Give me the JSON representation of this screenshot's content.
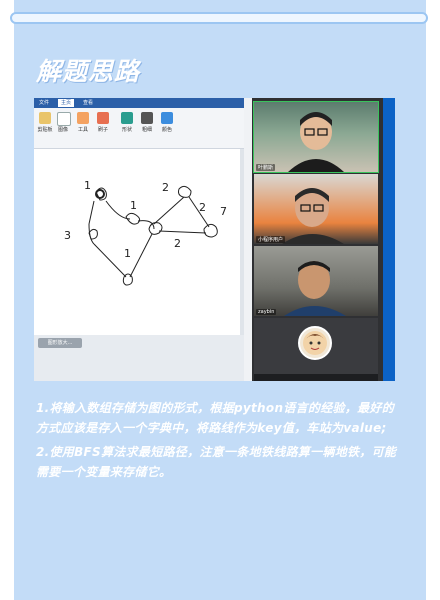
{
  "section_title": "解题思路",
  "screenshot": {
    "paint": {
      "tabs": [
        "文件",
        "主页",
        "查看"
      ],
      "ribbon_groups": [
        "剪贴板",
        "图像",
        "工具",
        "刷子",
        "形状",
        "粗细",
        "颜色"
      ],
      "status_button": "图形放大...",
      "sketch_labels": [
        "1",
        "1",
        "2",
        "2",
        "7",
        "3",
        "1",
        "2"
      ]
    },
    "video_tiles": [
      {
        "name": "叶鹏斯",
        "active": true
      },
      {
        "name": "小程序用户",
        "active": false
      },
      {
        "name": "zaybin",
        "active": false
      }
    ]
  },
  "paragraphs": [
    "1.将输入数组存储为图的形式，根据python语言的经验，最好的方式应该是存入一个字典中，将路线作为key值，车站为value;",
    "2.使用BFS算法求最短路径，注意一条地铁线路算一辆地铁，可能需要一个变量来存储它。"
  ],
  "colors": {
    "panel_bg": "#c3dcf7",
    "text": "#ffffff",
    "accent": "#0b62c6"
  }
}
